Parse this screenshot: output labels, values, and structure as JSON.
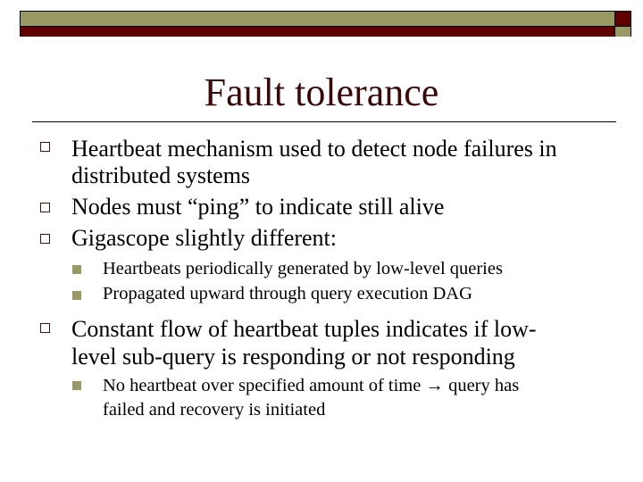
{
  "slide": {
    "title": "Fault tolerance",
    "colors": {
      "olive": "#999966",
      "dark_red": "#600000",
      "title": "#3a0808"
    },
    "bullets": [
      {
        "lines": [
          "Heartbeat mechanism used to detect node failures in",
          "distributed systems"
        ]
      },
      {
        "lines": [
          "Nodes must “ping” to indicate still alive"
        ]
      },
      {
        "lines": [
          "Gigascope slightly different:"
        ],
        "sub": [
          {
            "lines": [
              "Heartbeats periodically generated by low-level queries"
            ]
          },
          {
            "lines": [
              "Propagated upward through query execution DAG"
            ]
          }
        ]
      },
      {
        "lines": [
          "Constant flow of heartbeat tuples indicates if low-",
          "level sub-query is responding or not responding"
        ],
        "sub": [
          {
            "lines": [
              "No heartbeat over specified amount of time → query has",
              "failed and recovery is initiated"
            ]
          }
        ]
      }
    ]
  }
}
